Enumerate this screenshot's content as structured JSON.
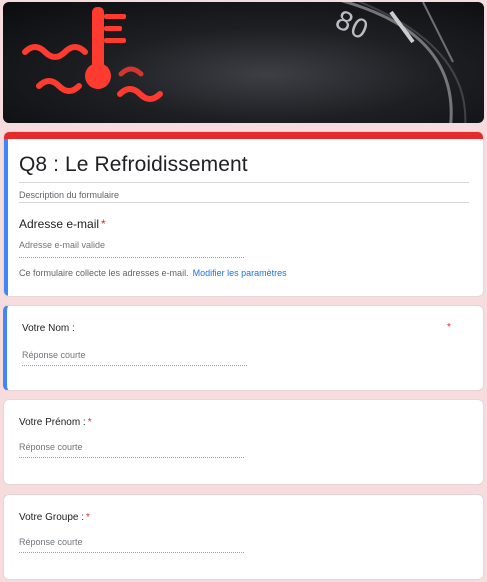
{
  "form": {
    "title": "Q8 : Le Refroidissement",
    "description_placeholder": "Description du formulaire",
    "email": {
      "label": "Adresse e-mail",
      "required_mark": "*",
      "placeholder": "Adresse e-mail valide"
    },
    "collect_note": "Ce formulaire collecte les adresses e-mail.",
    "collect_link": "Modifier les paramètres"
  },
  "questions": [
    {
      "label": "Votre Nom :",
      "required_mark": "*",
      "placeholder": "Réponse courte"
    },
    {
      "label": "Votre Prénom :",
      "required_mark": "*",
      "placeholder": "Réponse courte"
    },
    {
      "label": "Votre Groupe :",
      "required_mark": "*",
      "placeholder": "Réponse courte"
    }
  ],
  "colors": {
    "accent": "#e52b2b",
    "focus": "#4285f4",
    "background": "#f6dcdc",
    "link": "#1a73e8",
    "required": "#d93025"
  }
}
